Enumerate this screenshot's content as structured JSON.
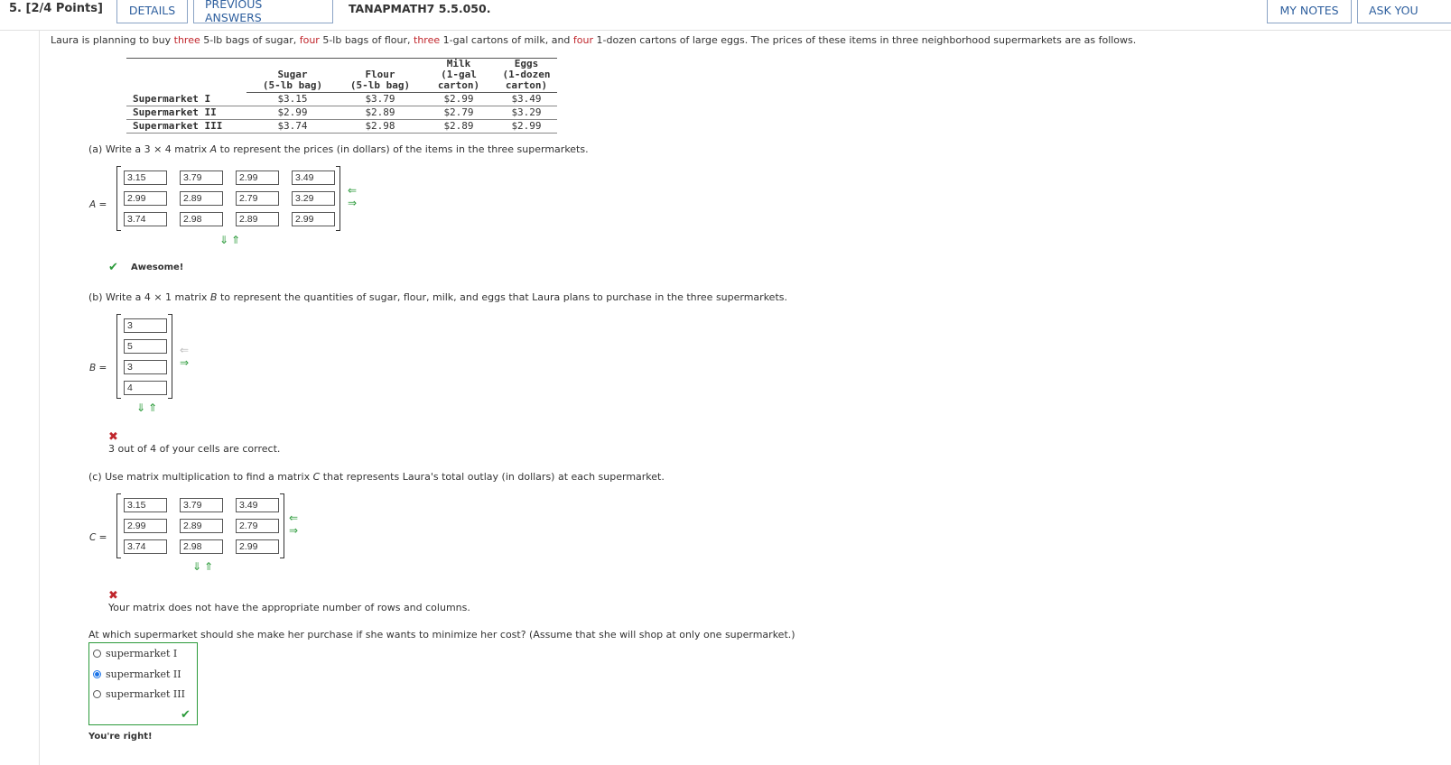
{
  "header": {
    "question_number": "5. [2/4 Points]",
    "details_label": "DETAILS",
    "previous_answers_label": "PREVIOUS ANSWERS",
    "code": "TANAPMATH7 5.5.050.",
    "my_notes_label": "MY NOTES",
    "ask_label": "ASK YOU"
  },
  "intro": {
    "p1": "Laura is planning to buy ",
    "q1": "three",
    "p2": " 5-lb bags of sugar, ",
    "q2": "four",
    "p3": " 5-lb bags of flour, ",
    "q3": "three",
    "p4": " 1-gal cartons of milk, and ",
    "q4": "four",
    "p5": " 1-dozen cartons of large eggs. The prices of these items in three neighborhood supermarkets are as follows."
  },
  "price_table": {
    "headers": [
      [
        "Sugar",
        "(5-lb bag)"
      ],
      [
        "Flour",
        "(5-lb bag)"
      ],
      [
        "Milk",
        "(1-gal",
        "carton)"
      ],
      [
        "Eggs",
        "(1-dozen",
        "carton)"
      ]
    ],
    "rows": [
      {
        "label": "Supermarket I",
        "values": [
          "$3.15",
          "$3.79",
          "$2.99",
          "$3.49"
        ]
      },
      {
        "label": "Supermarket II",
        "values": [
          "$2.99",
          "$2.89",
          "$2.79",
          "$3.29"
        ]
      },
      {
        "label": "Supermarket III",
        "values": [
          "$3.74",
          "$2.98",
          "$2.89",
          "$2.99"
        ]
      }
    ]
  },
  "part_a": {
    "prompt_pre": "(a) Write a 3 × 4 matrix ",
    "var": "A",
    "prompt_post": " to represent the prices (in dollars) of the items in the three supermarkets.",
    "label": "A =",
    "cells": [
      [
        "3.15",
        "3.79",
        "2.99",
        "3.49"
      ],
      [
        "2.99",
        "2.89",
        "2.79",
        "3.29"
      ],
      [
        "3.74",
        "2.98",
        "2.89",
        "2.99"
      ]
    ],
    "feedback": "Awesome!"
  },
  "part_b": {
    "prompt_pre": "(b) Write a 4 × 1 matrix ",
    "var": "B",
    "prompt_post": " to represent the quantities of sugar, flour, milk, and eggs that Laura plans to purchase in the three supermarkets.",
    "label": "B =",
    "cells": [
      "3",
      "5",
      "3",
      "4"
    ],
    "feedback": "3 out of 4 of your cells are correct."
  },
  "part_c": {
    "prompt_pre": "(c) Use matrix multiplication to find a matrix ",
    "var": "C",
    "prompt_post": " that represents Laura's total outlay (in dollars) at each supermarket.",
    "label": "C =",
    "cells": [
      [
        "3.15",
        "3.79",
        "3.49"
      ],
      [
        "2.99",
        "2.89",
        "2.79"
      ],
      [
        "3.74",
        "2.98",
        "2.99"
      ]
    ],
    "feedback": "Your matrix does not have the appropriate number of rows and columns."
  },
  "part_d": {
    "prompt": "At which supermarket should she make her purchase if she wants to minimize her cost? (Assume that she will shop at only one supermarket.)",
    "options": [
      "supermarket I",
      "supermarket II",
      "supermarket III"
    ],
    "selected_index": 1,
    "feedback": "You're right!"
  },
  "colors": {
    "correct": "#2b9a3a",
    "incorrect": "#c0262c",
    "link": "#2e5f9e"
  },
  "icons": {
    "arrows": [
      "arrow-left-icon",
      "arrow-right-icon",
      "arrow-down-icon",
      "arrow-up-icon"
    ],
    "check": "check-icon",
    "x": "x-mark-icon"
  }
}
